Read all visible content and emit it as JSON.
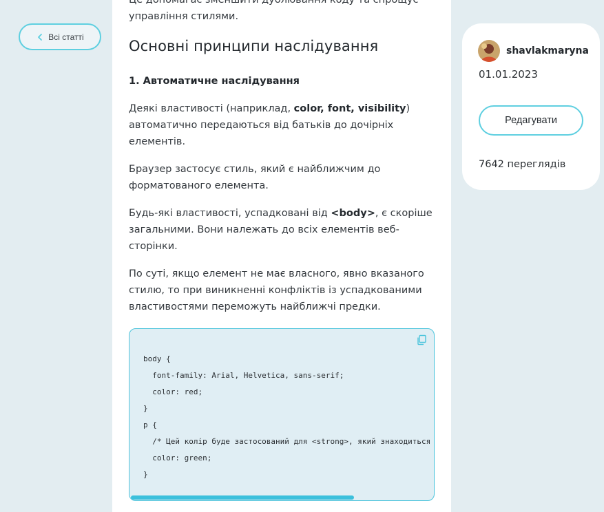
{
  "nav": {
    "back_label": "Всі статті"
  },
  "article": {
    "intro": "Це допомагає зменшити дублювання коду та спрощує управління стилями.",
    "heading": "Основні принципи наслідування",
    "subheading": "1. Автоматичне наслідування",
    "p1_before": "Деякі властивості (наприклад, ",
    "p1_bold": "color, font, visibility",
    "p1_after": ") автоматично передаються від батьків до дочірніх елементів.",
    "p2": "Браузер застосує стиль, який є найближчим до форматованого елемента.",
    "p3_before": "Будь-які властивості, успадковані від ",
    "p3_bold": "<body>",
    "p3_after": ", є скоріше загальними. Вони належать до всіх елементів веб-сторінки.",
    "p4": "По суті, якщо елемент не має власного, явно вказаного стилю, то при виникненні конфліктів із успадкованими властивостями переможуть найближчі предки."
  },
  "code": {
    "lines": [
      "body {",
      "  font-family: Arial, Helvetica, sans-serif;",
      "  color: red;",
      "}",
      "p {",
      "  /* Цей колір буде застосований для <strong>, який знаходиться",
      "  color: green;",
      "}"
    ],
    "copy_icon": "copy-icon",
    "scroll_position": 0.73
  },
  "author": {
    "name": "shavlakmaryna",
    "date": "01.01.2023",
    "edit_label": "Редагувати",
    "views": "7642 переглядів"
  },
  "colors": {
    "accent": "#4cc4dc",
    "page_bg": "#e3edf1",
    "code_bg": "#e0eef4"
  }
}
